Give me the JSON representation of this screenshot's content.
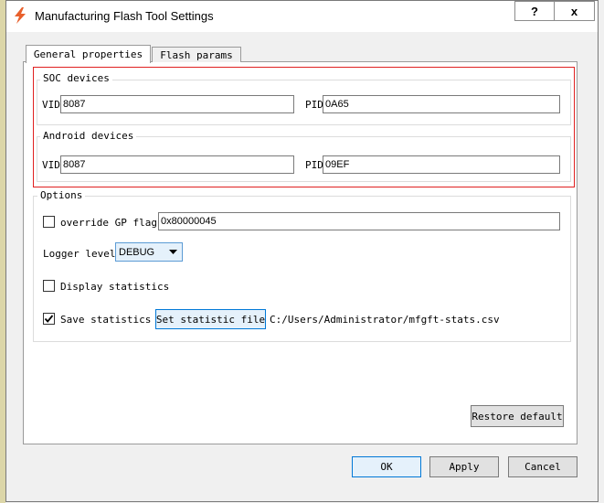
{
  "window": {
    "title": "Manufacturing Flash Tool Settings",
    "help_label": "?",
    "close_label": "x"
  },
  "tabs": [
    {
      "label": "General properties",
      "active": true
    },
    {
      "label": "Flash params",
      "active": false
    }
  ],
  "soc": {
    "title": "SOC devices",
    "vid_label": "VID",
    "vid_value": "8087",
    "pid_label": "PID",
    "pid_value": "0A65"
  },
  "android": {
    "title": "Android devices",
    "vid_label": "VID",
    "vid_value": "8087",
    "pid_label": "PID",
    "pid_value": "09EF"
  },
  "options": {
    "title": "Options",
    "override_label": "override GP flag",
    "override_checked": false,
    "override_value": "0x80000045",
    "logger_label": "Logger level",
    "logger_value": "DEBUG",
    "display_stats_label": "Display statistics",
    "display_stats_checked": false,
    "save_stats_label": "Save statistics",
    "save_stats_checked": true,
    "set_file_button": "Set statistic file",
    "stats_path": "C:/Users/Administrator/mfgft-stats.csv"
  },
  "restore_button": "Restore default",
  "footer": {
    "ok": "OK",
    "apply": "Apply",
    "cancel": "Cancel"
  },
  "colors": {
    "highlight_border": "#e02020",
    "accent_blue": "#0078d7",
    "icon_orange": "#e8602c"
  }
}
